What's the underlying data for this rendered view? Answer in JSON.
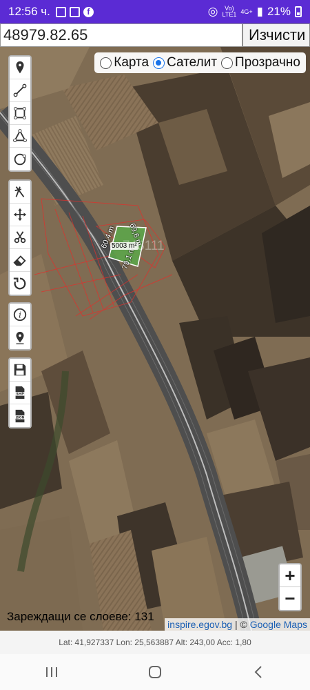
{
  "statusbar": {
    "time": "12:56 ч.",
    "network": "Vo)",
    "lte": "LTE1",
    "gen": "4G+",
    "battery": "21%"
  },
  "search": {
    "value": "48979.82.65",
    "clear_label": "Изчисти"
  },
  "layers": {
    "options": [
      {
        "label": "Карта",
        "selected": false
      },
      {
        "label": "Сателит",
        "selected": true
      },
      {
        "label": "Прозрачно",
        "selected": false
      }
    ]
  },
  "tools": {
    "group1": [
      "marker-icon",
      "polyline-icon",
      "polygon-icon",
      "path-icon",
      "circle-icon"
    ],
    "group2": [
      "cut-icon",
      "move-icon",
      "scissors-icon",
      "eraser-icon",
      "rotate-icon"
    ],
    "group3": [
      "info-icon",
      "pin-location-icon"
    ],
    "group4": [
      "save-icon",
      "shp-export-icon",
      "json-export-icon"
    ]
  },
  "map": {
    "parcel_id": "748111",
    "measure_top": "60,4 m",
    "measure_right": "69,6 m",
    "measure_bottom": "79,1 m",
    "area": "5003 m²",
    "loading_text": "Зареждащи се слоеве: 131",
    "attribution_source": "inspire.egov.bg",
    "attribution_sep": " | © ",
    "attribution_google": "Google Maps"
  },
  "zoom": {
    "in": "+",
    "out": "−"
  },
  "gps": {
    "text": "Lat: 41,927337 Lon: 25,563887 Alt: 243,00 Acc: 1,80"
  }
}
